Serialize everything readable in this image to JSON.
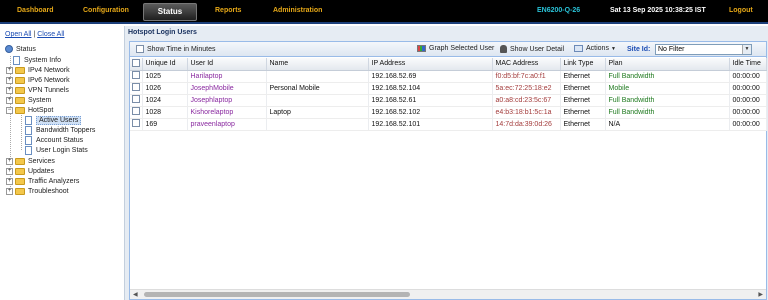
{
  "topnav": {
    "items": [
      "Dashboard",
      "Configuration",
      "Status",
      "Reports",
      "Administration"
    ],
    "active": "Status",
    "model": "EN6200-Q-26",
    "datetime": "Sat 13 Sep 2025 10:38:25 IST",
    "logout": "Logout",
    "accent_color": "#e6a817"
  },
  "sidebar": {
    "open_all": "Open All",
    "separator": "|",
    "close_all": "Close All",
    "root": "Status",
    "items": [
      "System Info",
      "IPv4 Network",
      "IPv6 Network",
      "VPN Tunnels",
      "System",
      "HotSpot",
      "Services",
      "Updates",
      "Traffic Analyzers",
      "Troubleshoot"
    ],
    "hotspot_children": [
      "Active Users",
      "Bandwidth Toppers",
      "Account Status",
      "User Login Stats"
    ],
    "selected": "Active Users"
  },
  "panel": {
    "title": "Hotspot Login Users",
    "toolbar": {
      "show_time": "Show Time in Minutes",
      "graph": "Graph Selected User",
      "detail": "Show User Detail",
      "actions": "Actions",
      "site_label": "Site Id:",
      "site_value": "No Filter"
    },
    "columns": [
      "Unique Id",
      "User Id",
      "Name",
      "IP Address",
      "MAC Address",
      "Link Type",
      "Plan",
      "Idle Time"
    ],
    "rows": [
      {
        "uid": "1025",
        "user": "Harilaptop",
        "name": "",
        "ip": "192.168.52.69",
        "mac": "f0:d5:bf:7c:a0:f1",
        "link": "Ethernet",
        "plan": "Full Bandwidth",
        "idle": "00:00:00"
      },
      {
        "uid": "1026",
        "user": "JosephMobile",
        "name": "Personal Mobile",
        "ip": "192.168.52.104",
        "mac": "5a:ec:72:25:18:e2",
        "link": "Ethernet",
        "plan": "Mobile",
        "idle": "00:00:00"
      },
      {
        "uid": "1024",
        "user": "Josephlaptop",
        "name": "",
        "ip": "192.168.52.61",
        "mac": "a0:a8:cd:23:5c:67",
        "link": "Ethernet",
        "plan": "Full Bandwidth",
        "idle": "00:00:00"
      },
      {
        "uid": "1028",
        "user": "Kishorelaptop",
        "name": "Laptop",
        "ip": "192.168.52.102",
        "mac": "e4:b3:18:b1:5c:1a",
        "link": "Ethernet",
        "plan": "Full Bandwidth",
        "idle": "00:00:00"
      },
      {
        "uid": "169",
        "user": "praveenlaptop",
        "name": "",
        "ip": "192.168.52.101",
        "mac": "14:7d:da:39:0d:26",
        "link": "Ethernet",
        "plan": "N/A",
        "idle": "00:00:00"
      }
    ]
  }
}
